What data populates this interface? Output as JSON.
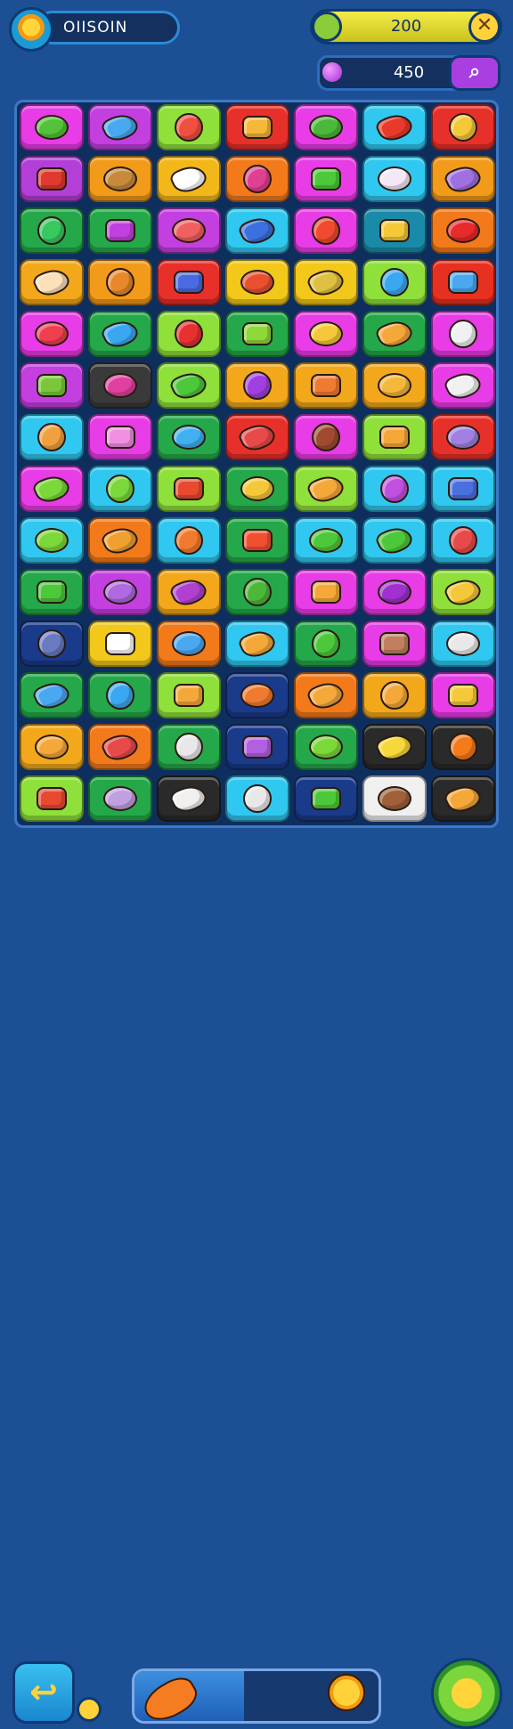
{
  "header": {
    "player_name": "OIISOIN",
    "coins": "200",
    "gems": "450",
    "icons": {
      "level_badge": "gear-icon",
      "coin": "coin-icon",
      "close": "close-icon",
      "gem": "gem-icon",
      "profile": "search-icon"
    }
  },
  "board": {
    "rows": 14,
    "columns": 7,
    "tiles": [
      [
        [
          "#e83ce6",
          "#52c23a"
        ],
        [
          "#c43fe0",
          "#4aa8f0"
        ],
        [
          "#8fe03a",
          "#f05040"
        ],
        [
          "#e8302a",
          "#f5b83a"
        ],
        [
          "#e83ce6",
          "#4cb83a"
        ],
        [
          "#30c8f0",
          "#e83a2a"
        ],
        [
          "#e8302a",
          "#f5c83a"
        ]
      ],
      [
        [
          "#b43fd8",
          "#e03a30"
        ],
        [
          "#f29a1a",
          "#c88a3a"
        ],
        [
          "#f2b81a",
          "#ffffff"
        ],
        [
          "#f27a1a",
          "#e04090"
        ],
        [
          "#e83ce6",
          "#4cc83a"
        ],
        [
          "#30c8f0",
          "#f4e8f8"
        ],
        [
          "#f29a1a",
          "#a070e0"
        ]
      ],
      [
        [
          "#24a84a",
          "#38c860"
        ],
        [
          "#24a84a",
          "#c040e0"
        ],
        [
          "#c43fe0",
          "#f06060"
        ],
        [
          "#30c8f0",
          "#3a70e0"
        ],
        [
          "#e83ce6",
          "#f04a30"
        ],
        [
          "#1a8aa8",
          "#f5c83a"
        ],
        [
          "#f27a1a",
          "#e82a2a"
        ]
      ],
      [
        [
          "#f2a81a",
          "#fce0b8"
        ],
        [
          "#f29a1a",
          "#e8882a"
        ],
        [
          "#e8302a",
          "#4a6ae0"
        ],
        [
          "#f2c81a",
          "#e85030"
        ],
        [
          "#f2c81a",
          "#e0c040"
        ],
        [
          "#8fe03a",
          "#3aa8f0"
        ],
        [
          "#e83020",
          "#4aa8f0"
        ]
      ],
      [
        [
          "#e83ce6",
          "#f04050"
        ],
        [
          "#24a84a",
          "#3aa8f0"
        ],
        [
          "#8fe03a",
          "#e83030"
        ],
        [
          "#24a84a",
          "#8fd83a"
        ],
        [
          "#e83ce6",
          "#f5c83a"
        ],
        [
          "#24a84a",
          "#f5a83a"
        ],
        [
          "#e83ce6",
          "#f0f0f0"
        ]
      ],
      [
        [
          "#c43fe0",
          "#7ac83a"
        ],
        [
          "#3a3a3a",
          "#e040a0"
        ],
        [
          "#8fe03a",
          "#4cc83a"
        ],
        [
          "#f2a81a",
          "#a040e0"
        ],
        [
          "#f2a81a",
          "#f07a30"
        ],
        [
          "#f2a81a",
          "#f5b83a"
        ],
        [
          "#e83ce6",
          "#f0f0f0"
        ]
      ],
      [
        [
          "#30c8f0",
          "#f0a040"
        ],
        [
          "#e83ce6",
          "#f090e0"
        ],
        [
          "#24a84a",
          "#40b0f0"
        ],
        [
          "#e8302a",
          "#e84a4a"
        ],
        [
          "#e83ce6",
          "#a04a30"
        ],
        [
          "#8fe03a",
          "#f5a83a"
        ],
        [
          "#e8302a",
          "#a080e0"
        ]
      ],
      [
        [
          "#e83ce6",
          "#7ad83a"
        ],
        [
          "#30c8f0",
          "#7ad83a"
        ],
        [
          "#8fe03a",
          "#e84a30"
        ],
        [
          "#24a84a",
          "#f5c83a"
        ],
        [
          "#8fe03a",
          "#f5a83a"
        ],
        [
          "#30c8f0",
          "#c050e0"
        ],
        [
          "#30c8f0",
          "#4a70e0"
        ]
      ],
      [
        [
          "#30c8f0",
          "#7ad83a"
        ],
        [
          "#f27a1a",
          "#f0a030"
        ],
        [
          "#30c8f0",
          "#f07a30"
        ],
        [
          "#24a84a",
          "#f05030"
        ],
        [
          "#30c8f0",
          "#4cc83a"
        ],
        [
          "#30c8f0",
          "#4cc83a"
        ],
        [
          "#30c8f0",
          "#e84a4a"
        ]
      ],
      [
        [
          "#24a84a",
          "#4cc83a"
        ],
        [
          "#c43fe0",
          "#b06ae0"
        ],
        [
          "#f2a81a",
          "#b040d0"
        ],
        [
          "#24a84a",
          "#4cb83a"
        ],
        [
          "#e83ce6",
          "#f5a83a"
        ],
        [
          "#e83ce6",
          "#a030d0"
        ],
        [
          "#8fe03a",
          "#f5c83a"
        ]
      ],
      [
        [
          "#1a3a8a",
          "#6a7ac0"
        ],
        [
          "#f2c81a",
          "#ffffff"
        ],
        [
          "#f27a1a",
          "#4aa8f0"
        ],
        [
          "#30c8f0",
          "#f5a83a"
        ],
        [
          "#24a84a",
          "#4cc83a"
        ],
        [
          "#e83ce6",
          "#c08060"
        ],
        [
          "#30c8f0",
          "#e8e8e8"
        ]
      ],
      [
        [
          "#24a84a",
          "#4aa8f0"
        ],
        [
          "#24a84a",
          "#3aa8f0"
        ],
        [
          "#8fe03a",
          "#f5a83a"
        ],
        [
          "#1a3a8a",
          "#f07a30"
        ],
        [
          "#f27a1a",
          "#f5a83a"
        ],
        [
          "#f2a81a",
          "#f5a83a"
        ],
        [
          "#e83ce6",
          "#f5c83a"
        ]
      ],
      [
        [
          "#f2a81a",
          "#f5a83a"
        ],
        [
          "#f27a1a",
          "#e84a4a"
        ],
        [
          "#24a84a",
          "#e8e8e8"
        ],
        [
          "#1a3a8a",
          "#b060e0"
        ],
        [
          "#24a84a",
          "#7ad83a"
        ],
        [
          "#2a2a2a",
          "#f5d83a"
        ],
        [
          "#2a2a2a",
          "#f57a1a"
        ]
      ],
      [
        [
          "#8fe03a",
          "#e84a30"
        ],
        [
          "#24a84a",
          "#c0a0e0"
        ],
        [
          "#2a2a2a",
          "#f0f0f0"
        ],
        [
          "#30c8f0",
          "#e8e8e8"
        ],
        [
          "#1a3a8a",
          "#4cc83a"
        ],
        [
          "#f0f0f0",
          "#a0603a"
        ],
        [
          "#2a2a2a",
          "#f5a83a"
        ]
      ]
    ]
  },
  "footer": {
    "level_progress": 0.45,
    "icons": {
      "back": "back-arrow-icon",
      "badge": "coin-icon",
      "progress_start": "carrot-icon",
      "progress_end": "sun-icon",
      "hint": "magnifier-icon"
    }
  }
}
